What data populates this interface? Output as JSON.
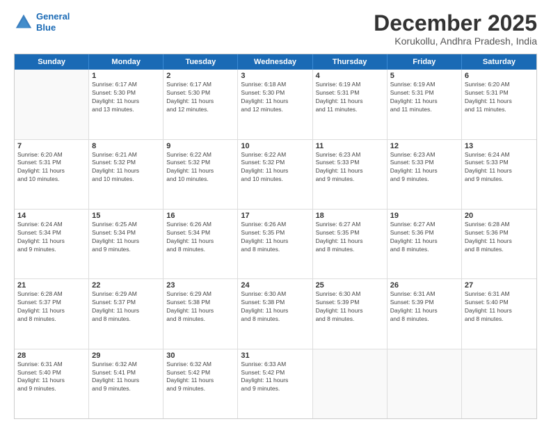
{
  "header": {
    "logo_line1": "General",
    "logo_line2": "Blue",
    "title": "December 2025",
    "subtitle": "Korukollu, Andhra Pradesh, India"
  },
  "days_of_week": [
    "Sunday",
    "Monday",
    "Tuesday",
    "Wednesday",
    "Thursday",
    "Friday",
    "Saturday"
  ],
  "weeks": [
    [
      {
        "num": "",
        "info": ""
      },
      {
        "num": "1",
        "info": "Sunrise: 6:17 AM\nSunset: 5:30 PM\nDaylight: 11 hours\nand 13 minutes."
      },
      {
        "num": "2",
        "info": "Sunrise: 6:17 AM\nSunset: 5:30 PM\nDaylight: 11 hours\nand 12 minutes."
      },
      {
        "num": "3",
        "info": "Sunrise: 6:18 AM\nSunset: 5:30 PM\nDaylight: 11 hours\nand 12 minutes."
      },
      {
        "num": "4",
        "info": "Sunrise: 6:19 AM\nSunset: 5:31 PM\nDaylight: 11 hours\nand 11 minutes."
      },
      {
        "num": "5",
        "info": "Sunrise: 6:19 AM\nSunset: 5:31 PM\nDaylight: 11 hours\nand 11 minutes."
      },
      {
        "num": "6",
        "info": "Sunrise: 6:20 AM\nSunset: 5:31 PM\nDaylight: 11 hours\nand 11 minutes."
      }
    ],
    [
      {
        "num": "7",
        "info": "Sunrise: 6:20 AM\nSunset: 5:31 PM\nDaylight: 11 hours\nand 10 minutes."
      },
      {
        "num": "8",
        "info": "Sunrise: 6:21 AM\nSunset: 5:32 PM\nDaylight: 11 hours\nand 10 minutes."
      },
      {
        "num": "9",
        "info": "Sunrise: 6:22 AM\nSunset: 5:32 PM\nDaylight: 11 hours\nand 10 minutes."
      },
      {
        "num": "10",
        "info": "Sunrise: 6:22 AM\nSunset: 5:32 PM\nDaylight: 11 hours\nand 10 minutes."
      },
      {
        "num": "11",
        "info": "Sunrise: 6:23 AM\nSunset: 5:33 PM\nDaylight: 11 hours\nand 9 minutes."
      },
      {
        "num": "12",
        "info": "Sunrise: 6:23 AM\nSunset: 5:33 PM\nDaylight: 11 hours\nand 9 minutes."
      },
      {
        "num": "13",
        "info": "Sunrise: 6:24 AM\nSunset: 5:33 PM\nDaylight: 11 hours\nand 9 minutes."
      }
    ],
    [
      {
        "num": "14",
        "info": "Sunrise: 6:24 AM\nSunset: 5:34 PM\nDaylight: 11 hours\nand 9 minutes."
      },
      {
        "num": "15",
        "info": "Sunrise: 6:25 AM\nSunset: 5:34 PM\nDaylight: 11 hours\nand 9 minutes."
      },
      {
        "num": "16",
        "info": "Sunrise: 6:26 AM\nSunset: 5:34 PM\nDaylight: 11 hours\nand 8 minutes."
      },
      {
        "num": "17",
        "info": "Sunrise: 6:26 AM\nSunset: 5:35 PM\nDaylight: 11 hours\nand 8 minutes."
      },
      {
        "num": "18",
        "info": "Sunrise: 6:27 AM\nSunset: 5:35 PM\nDaylight: 11 hours\nand 8 minutes."
      },
      {
        "num": "19",
        "info": "Sunrise: 6:27 AM\nSunset: 5:36 PM\nDaylight: 11 hours\nand 8 minutes."
      },
      {
        "num": "20",
        "info": "Sunrise: 6:28 AM\nSunset: 5:36 PM\nDaylight: 11 hours\nand 8 minutes."
      }
    ],
    [
      {
        "num": "21",
        "info": "Sunrise: 6:28 AM\nSunset: 5:37 PM\nDaylight: 11 hours\nand 8 minutes."
      },
      {
        "num": "22",
        "info": "Sunrise: 6:29 AM\nSunset: 5:37 PM\nDaylight: 11 hours\nand 8 minutes."
      },
      {
        "num": "23",
        "info": "Sunrise: 6:29 AM\nSunset: 5:38 PM\nDaylight: 11 hours\nand 8 minutes."
      },
      {
        "num": "24",
        "info": "Sunrise: 6:30 AM\nSunset: 5:38 PM\nDaylight: 11 hours\nand 8 minutes."
      },
      {
        "num": "25",
        "info": "Sunrise: 6:30 AM\nSunset: 5:39 PM\nDaylight: 11 hours\nand 8 minutes."
      },
      {
        "num": "26",
        "info": "Sunrise: 6:31 AM\nSunset: 5:39 PM\nDaylight: 11 hours\nand 8 minutes."
      },
      {
        "num": "27",
        "info": "Sunrise: 6:31 AM\nSunset: 5:40 PM\nDaylight: 11 hours\nand 8 minutes."
      }
    ],
    [
      {
        "num": "28",
        "info": "Sunrise: 6:31 AM\nSunset: 5:40 PM\nDaylight: 11 hours\nand 9 minutes."
      },
      {
        "num": "29",
        "info": "Sunrise: 6:32 AM\nSunset: 5:41 PM\nDaylight: 11 hours\nand 9 minutes."
      },
      {
        "num": "30",
        "info": "Sunrise: 6:32 AM\nSunset: 5:42 PM\nDaylight: 11 hours\nand 9 minutes."
      },
      {
        "num": "31",
        "info": "Sunrise: 6:33 AM\nSunset: 5:42 PM\nDaylight: 11 hours\nand 9 minutes."
      },
      {
        "num": "",
        "info": ""
      },
      {
        "num": "",
        "info": ""
      },
      {
        "num": "",
        "info": ""
      }
    ]
  ]
}
